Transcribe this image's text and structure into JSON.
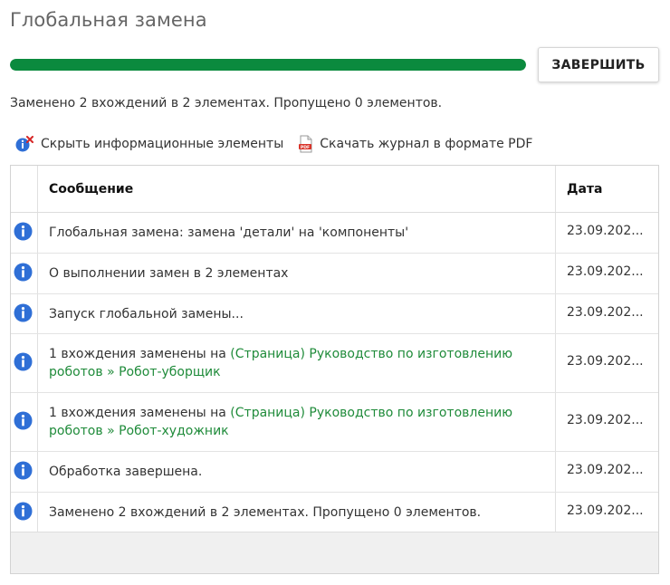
{
  "page": {
    "title": "Глобальная замена",
    "finish_button": "ЗАВЕРШИТЬ",
    "progress_percent": 100,
    "progress_color": "#0b8a3e",
    "summary": "Заменено 2 вхождений в 2 элементах. Пропущено 0 элементов."
  },
  "toolbar": {
    "hide_info_label": "Скрыть информационные элементы",
    "download_pdf_label": "Скачать журнал в формате PDF"
  },
  "table": {
    "headers": {
      "message": "Сообщение",
      "date": "Дата"
    },
    "rows": [
      {
        "icon": "info-icon",
        "text": "Глобальная замена: замена 'детали' на 'компоненты'",
        "date": "23.09.202..."
      },
      {
        "icon": "info-icon",
        "text": "О выполнении замен в 2 элементах",
        "date": "23.09.202..."
      },
      {
        "icon": "info-icon",
        "text": "Запуск глобальной замены...",
        "date": "23.09.202..."
      },
      {
        "icon": "info-icon",
        "prefix": "1 вхождения заменены на ",
        "link": "(Страница) Руководство по изготовлению роботов » Робот-уборщик",
        "date": "23.09.202..."
      },
      {
        "icon": "info-icon",
        "prefix": "1 вхождения заменены на ",
        "link": "(Страница) Руководство по изготовлению роботов » Робот-художник",
        "date": "23.09.202..."
      },
      {
        "icon": "info-icon",
        "text": "Обработка завершена.",
        "date": "23.09.202..."
      },
      {
        "icon": "info-icon",
        "text": "Заменено 2 вхождений в 2 элементах. Пропущено 0 элементов.",
        "date": "23.09.202..."
      }
    ]
  },
  "colors": {
    "link_green": "#1f8b3a",
    "info_blue": "#2f6fd6"
  }
}
